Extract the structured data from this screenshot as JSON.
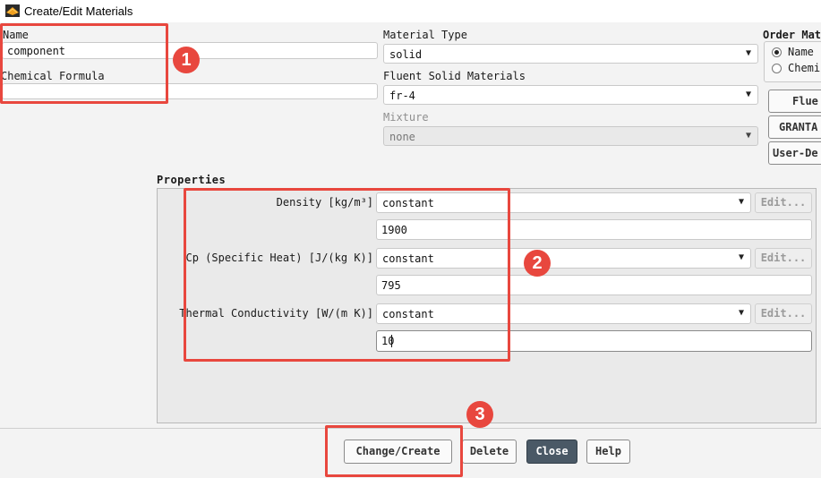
{
  "window": {
    "title": "Create/Edit Materials"
  },
  "name_field": {
    "label": "Name",
    "value": "component"
  },
  "chemical_formula": {
    "label": "Chemical Formula",
    "value": ""
  },
  "material_type": {
    "label": "Material Type",
    "value": "solid"
  },
  "fluent_solid_materials": {
    "label": "Fluent Solid Materials",
    "value": "fr-4"
  },
  "mixture": {
    "label": "Mixture",
    "value": "none"
  },
  "order_materials": {
    "label": "Order Mat",
    "options": [
      {
        "label": "Name",
        "selected": true
      },
      {
        "label": "Chemi",
        "selected": false
      }
    ]
  },
  "side_buttons": [
    "Flue",
    "GRANTA",
    "User-De"
  ],
  "properties": {
    "title": "Properties",
    "density": {
      "label": "Density [kg/m³]",
      "method": "constant",
      "value": "1900",
      "edit": "Edit..."
    },
    "cp": {
      "label": "Cp (Specific Heat) [J/(kg K)]",
      "method": "constant",
      "value": "795",
      "edit": "Edit..."
    },
    "thermal_conductivity": {
      "label": "Thermal Conductivity [W/(m K)]",
      "method": "constant",
      "value": "10",
      "edit": "Edit..."
    }
  },
  "footer": {
    "change_create": "Change/Create",
    "delete": "Delete",
    "close": "Close",
    "help": "Help"
  },
  "annotations": {
    "badge1": "1",
    "badge2": "2",
    "badge3": "3"
  },
  "colors": {
    "highlight": "#e8473e",
    "close_button": "#4a5966"
  }
}
